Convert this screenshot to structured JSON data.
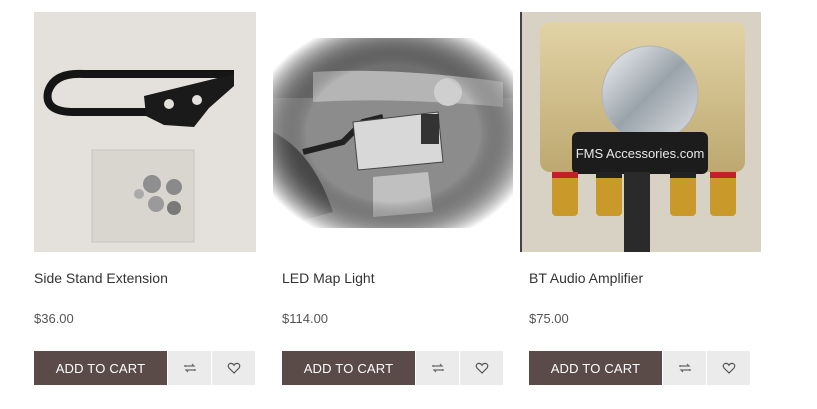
{
  "products": [
    {
      "title": "Side Stand Extension",
      "price": "$36.00",
      "cart_label": "ADD TO CART",
      "compare_icon": "compare-icon",
      "wishlist_icon": "heart-icon"
    },
    {
      "title": "LED Map Light",
      "price": "$114.00",
      "cart_label": "ADD TO CART",
      "compare_icon": "compare-icon",
      "wishlist_icon": "heart-icon"
    },
    {
      "title": "BT Audio Amplifier",
      "price": "$75.00",
      "cart_label": "ADD TO CART",
      "compare_icon": "compare-icon",
      "wishlist_icon": "heart-icon"
    }
  ],
  "amp_logo": "FMS Accessories.com",
  "colors": {
    "button": "#5a4a48",
    "icon_button": "#ebebeb"
  }
}
